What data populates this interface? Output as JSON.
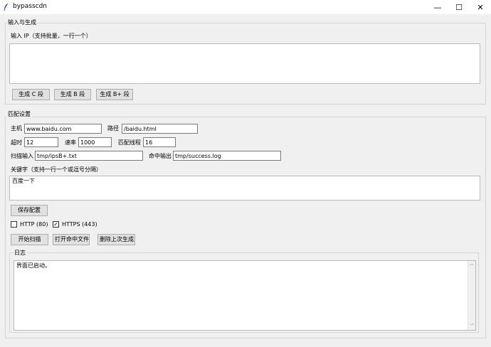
{
  "window": {
    "title": "bypasscdn",
    "minimize": "—",
    "maximize": "☐",
    "close": "✕"
  },
  "input_group": {
    "legend": "输入与生成",
    "ip_label": "输入 IP（支持批量，一行一个）",
    "ip_value": "",
    "buttons": [
      "生成 C 段",
      "生成 B 段",
      "生成 B+ 段"
    ]
  },
  "match_group": {
    "legend": "匹配设置",
    "host_label": "主机",
    "host_value": "www.baidu.com",
    "path_label": "路径",
    "path_value": "/baidu.html",
    "timeout_label": "超时",
    "timeout_value": "12",
    "rate_label": "速率",
    "rate_value": "1000",
    "threads_label": "匹配线程",
    "threads_value": "16",
    "scan_input_label": "扫描输入",
    "scan_input_value": "tmp/ipsB+.txt",
    "hit_output_label": "命中输出",
    "hit_output_value": "tmp/success.log",
    "keyword_label": "关键字（支持一行一个或逗号分隔）",
    "keyword_value": "百度一下",
    "save_button": "保存配置",
    "http_label": "HTTP (80)",
    "http_checked": false,
    "https_label": "HTTPS (443)",
    "https_checked": true,
    "start_button": "开始扫描",
    "open_hits_button": "打开命中文件",
    "delete_last_button": "删除上次生成"
  },
  "log_group": {
    "legend": "日志",
    "content": "界面已启动。"
  }
}
